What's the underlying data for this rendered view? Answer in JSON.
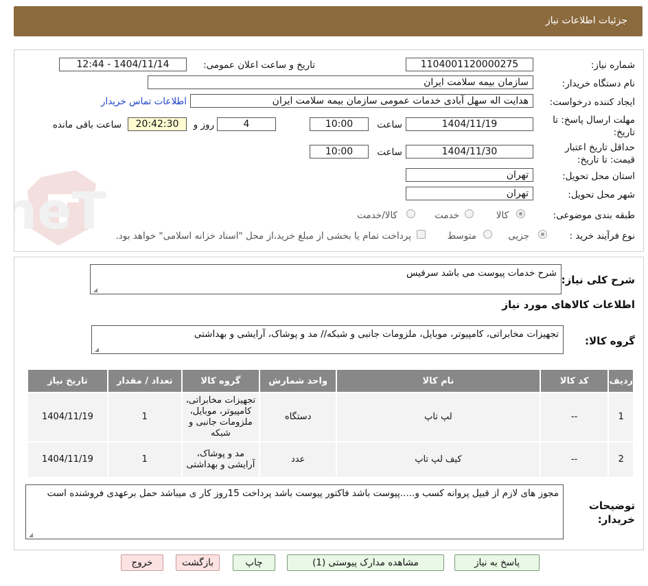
{
  "header": {
    "title": "جزئیات اطلاعات نیاز"
  },
  "watermark": {
    "text": "AriaTender.neT"
  },
  "form": {
    "need_number_label": "شماره نیاز:",
    "need_number": "1104001120000275",
    "announce_label": "تاریخ و ساعت اعلان عمومی:",
    "announce_value": "1404/11/14 - 12:44",
    "buyer_org_label": "نام دستگاه خریدار:",
    "buyer_org": "سازمان بیمه سلامت ایران",
    "creator_label": "ایجاد کننده درخواست:",
    "creator": "هدایت اله سهل آبادی خدمات عمومی سازمان بیمه سلامت ایران",
    "contact_link": "اطلاعات تماس خریدار",
    "deadline_label": "مهلت ارسال پاسخ: تا تاریخ:",
    "deadline_date": "1404/11/19",
    "time_label": "ساعت",
    "deadline_time": "10:00",
    "days_value": "4",
    "days_label": "روز و",
    "remaining_time": "20:42:30",
    "remaining_label": "ساعت باقی مانده",
    "validity_label": "حداقل تاریخ اعتبار قیمت: تا تاریخ:",
    "validity_date": "1404/11/30",
    "validity_time": "10:00",
    "province_label": "استان محل تحویل:",
    "province": "تهران",
    "city_label": "شهر محل تحویل:",
    "city": "تهران",
    "category_label": "طبقه بندی موضوعی:",
    "category_options": [
      "کالا",
      "خدمت",
      "کالا/خدمت"
    ],
    "purchase_type_label": "نوع فرآیند خرید :",
    "purchase_options": [
      "جزیی",
      "متوسط"
    ],
    "purchase_note": "پرداخت تمام یا بخشی از مبلغ خرید،از محل \"اسناد خزانه اسلامی\" خواهد بود."
  },
  "description": {
    "label": "شرح کلی نیاز:",
    "text": "شرح خدمات پیوست می باشد سرفیس"
  },
  "goods": {
    "section_title": "اطلاعات کالاهای مورد نیاز",
    "group_label": "گروه کالا:",
    "group_text": "تجهیزات مخابراتی، کامپیوتر، موبایل، ملزومات جانبی و شبکه// مد و پوشاک، آرایشی و بهداشتی"
  },
  "table": {
    "headers": [
      "ردیف",
      "کد کالا",
      "نام کالا",
      "واحد شمارش",
      "گروه کالا",
      "تعداد / مقدار",
      "تاریخ نیاز"
    ],
    "rows": [
      [
        "1",
        "--",
        "لپ تاپ",
        "دستگاه",
        "تجهیزات مخابراتی، کامپیوتر، موبایل، ملزومات جانبی و شبکه",
        "1",
        "1404/11/19"
      ],
      [
        "2",
        "--",
        "کیف لپ تاپ",
        "عدد",
        "مد و پوشاک، آرایشی و بهداشتی",
        "1",
        "1404/11/19"
      ]
    ]
  },
  "buyer_notes": {
    "label": "توضیحات خریدار:",
    "text": "مجوز های لازم از قبیل پروانه   کسب و.....پیوست باشد فاکتور پیوست باشد پرداخت 15روز کار ی  میباشد حمل برعهدی فروشنده است"
  },
  "buttons": {
    "reply": "پاسخ به نیاز",
    "attachments": "مشاهده مدارک پیوستی (1)",
    "print": "چاپ",
    "back": "بازگشت",
    "exit": "خروج"
  },
  "colors": {
    "header_bg": "#8b6a3e",
    "table_header_bg": "#888888",
    "button_green": "#eaf8e6",
    "button_pink": "#fde2e2"
  }
}
